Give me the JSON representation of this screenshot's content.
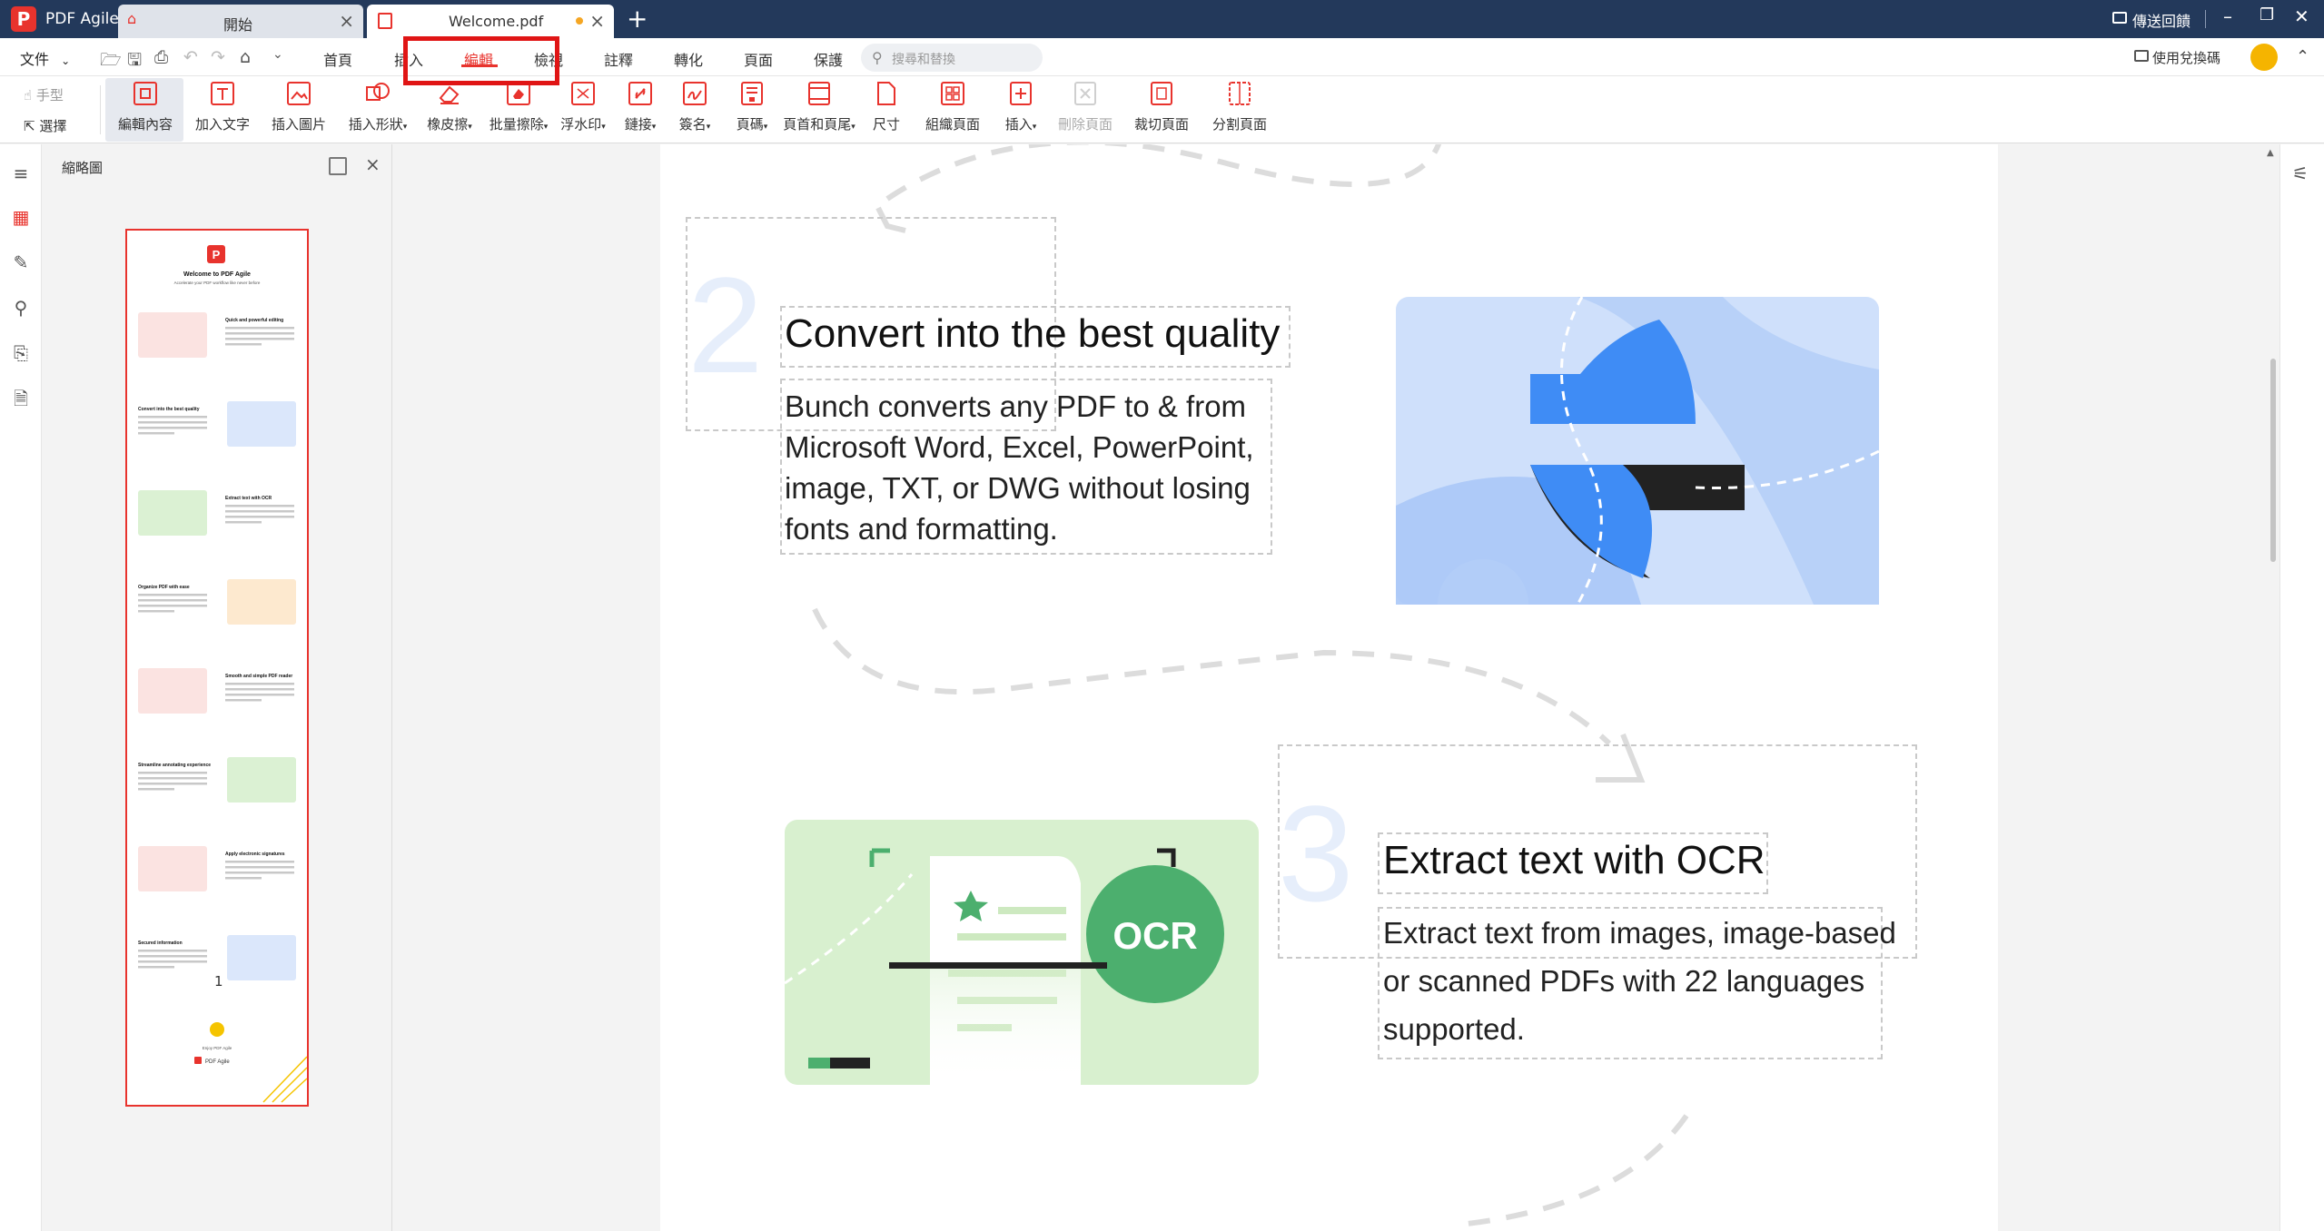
{
  "app": {
    "name": "PDF Agile",
    "logo_letter": "P"
  },
  "tabs": [
    {
      "label": "開始"
    },
    {
      "label": "Welcome.pdf"
    }
  ],
  "titlebar": {
    "feedback_label": "傳送回饋",
    "minimize": "–",
    "restore": "❐",
    "close": "✕"
  },
  "menu": {
    "file": "文件",
    "tabs": [
      "首頁",
      "插入",
      "編輯",
      "檢視",
      "註釋",
      "轉化",
      "頁面",
      "保護"
    ],
    "active_tab": "編輯",
    "search_placeholder": "搜尋和替換",
    "redeem_label": "使用兌換碼"
  },
  "ribbon": {
    "mode_hand": "手型",
    "mode_select": "選擇",
    "items": [
      {
        "label": "編輯內容"
      },
      {
        "label": "加入文字"
      },
      {
        "label": "插入圖片"
      },
      {
        "label": "插入形狀",
        "dropdown": true
      },
      {
        "label": "橡皮擦",
        "dropdown": true
      },
      {
        "label": "批量擦除",
        "dropdown": true
      },
      {
        "label": "浮水印",
        "dropdown": true
      },
      {
        "label": "鏈接",
        "dropdown": true
      },
      {
        "label": "簽名",
        "dropdown": true
      },
      {
        "label": "頁碼",
        "dropdown": true
      },
      {
        "label": "頁首和頁尾",
        "dropdown": true
      },
      {
        "label": "尺寸"
      },
      {
        "label": "組織頁面"
      },
      {
        "label": "插入",
        "dropdown": true
      },
      {
        "label": "刪除頁面",
        "disabled": true
      },
      {
        "label": "裁切頁面"
      },
      {
        "label": "分割頁面"
      }
    ]
  },
  "sidebar": {
    "title": "縮略圖",
    "page_number": "1",
    "thumbnail": {
      "title": "Welcome to PDF Agile",
      "subtitle": "Accelerate your PDF workflow like never before",
      "sections": [
        "Quick and powerful editing",
        "Convert into the best quality",
        "Extract text with OCR",
        "Organize PDF with ease",
        "Smooth and simple PDF reader",
        "Streamline annotating experience",
        "Apply electronic signatures",
        "Secured information"
      ],
      "footer_caption": "Enjoy PDF Agile",
      "footer_logo": "PDF Agile"
    }
  },
  "document": {
    "section2": {
      "number": "2",
      "heading": "Convert into the best quality",
      "lines": [
        "Bunch converts any PDF to & from",
        "Microsoft Word, Excel, PowerPoint,",
        "image, TXT, or DWG without losing",
        "fonts and formatting."
      ]
    },
    "section3": {
      "number": "3",
      "heading": "Extract text with OCR",
      "lines": [
        "Extract text from images, image-based",
        "or scanned PDFs with 22 languages",
        "supported."
      ],
      "badge": "OCR"
    }
  },
  "colors": {
    "accent_red": "#e8332d",
    "titlebar_navy": "#23395b",
    "convert_blue": "#3f8cf5",
    "convert_bg": "#cfe0fb",
    "ocr_green": "#4caf6e",
    "ocr_bg": "#d8f0cf"
  }
}
